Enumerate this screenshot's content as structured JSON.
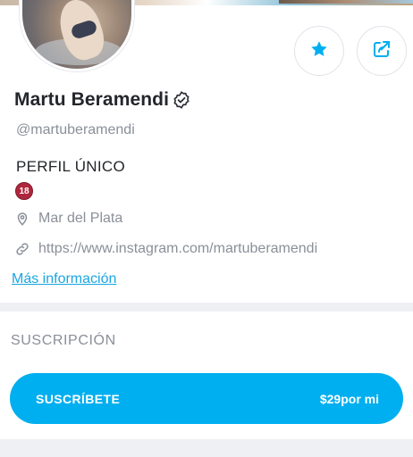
{
  "profile": {
    "name": "Martu Beramendi",
    "handle": "@martuberamendi",
    "bio": "PERFIL ÚNICO",
    "age_badge": "18",
    "location": "Mar del Plata",
    "website": "https://www.instagram.com/martuberamendi",
    "more_info_label": "Más información"
  },
  "subscription": {
    "section_title": "SUSCRIPCIÓN",
    "button_label": "SUSCRÍBETE",
    "price": "$29por mi"
  },
  "icons": {
    "favorite": "star-icon",
    "share": "share-icon",
    "verified": "verified-icon",
    "location": "location-pin-icon",
    "link": "link-icon"
  },
  "colors": {
    "accent": "#00aff0",
    "link": "#1aa6e0",
    "muted_text": "#8a8f98",
    "badge": "#b0263c"
  }
}
